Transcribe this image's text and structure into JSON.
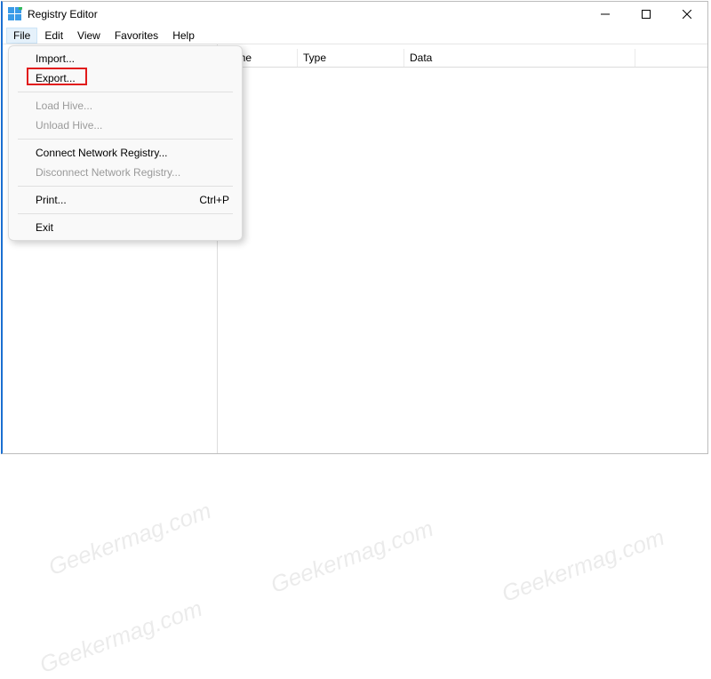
{
  "title": "Registry Editor",
  "menubar": [
    "File",
    "Edit",
    "View",
    "Favorites",
    "Help"
  ],
  "menubar_open_index": 0,
  "columns": {
    "name": "Name",
    "type": "Type",
    "data": "Data"
  },
  "file_menu": {
    "import": "Import...",
    "export": "Export...",
    "load_hive": "Load Hive...",
    "unload_hive": "Unload Hive...",
    "connect": "Connect Network Registry...",
    "disconnect": "Disconnect Network Registry...",
    "print": "Print...",
    "print_shortcut": "Ctrl+P",
    "exit": "Exit"
  },
  "watermark_text": "Geekermag.com",
  "colors": {
    "accent": "#1a6fd1",
    "highlight": "#e11b1b"
  }
}
